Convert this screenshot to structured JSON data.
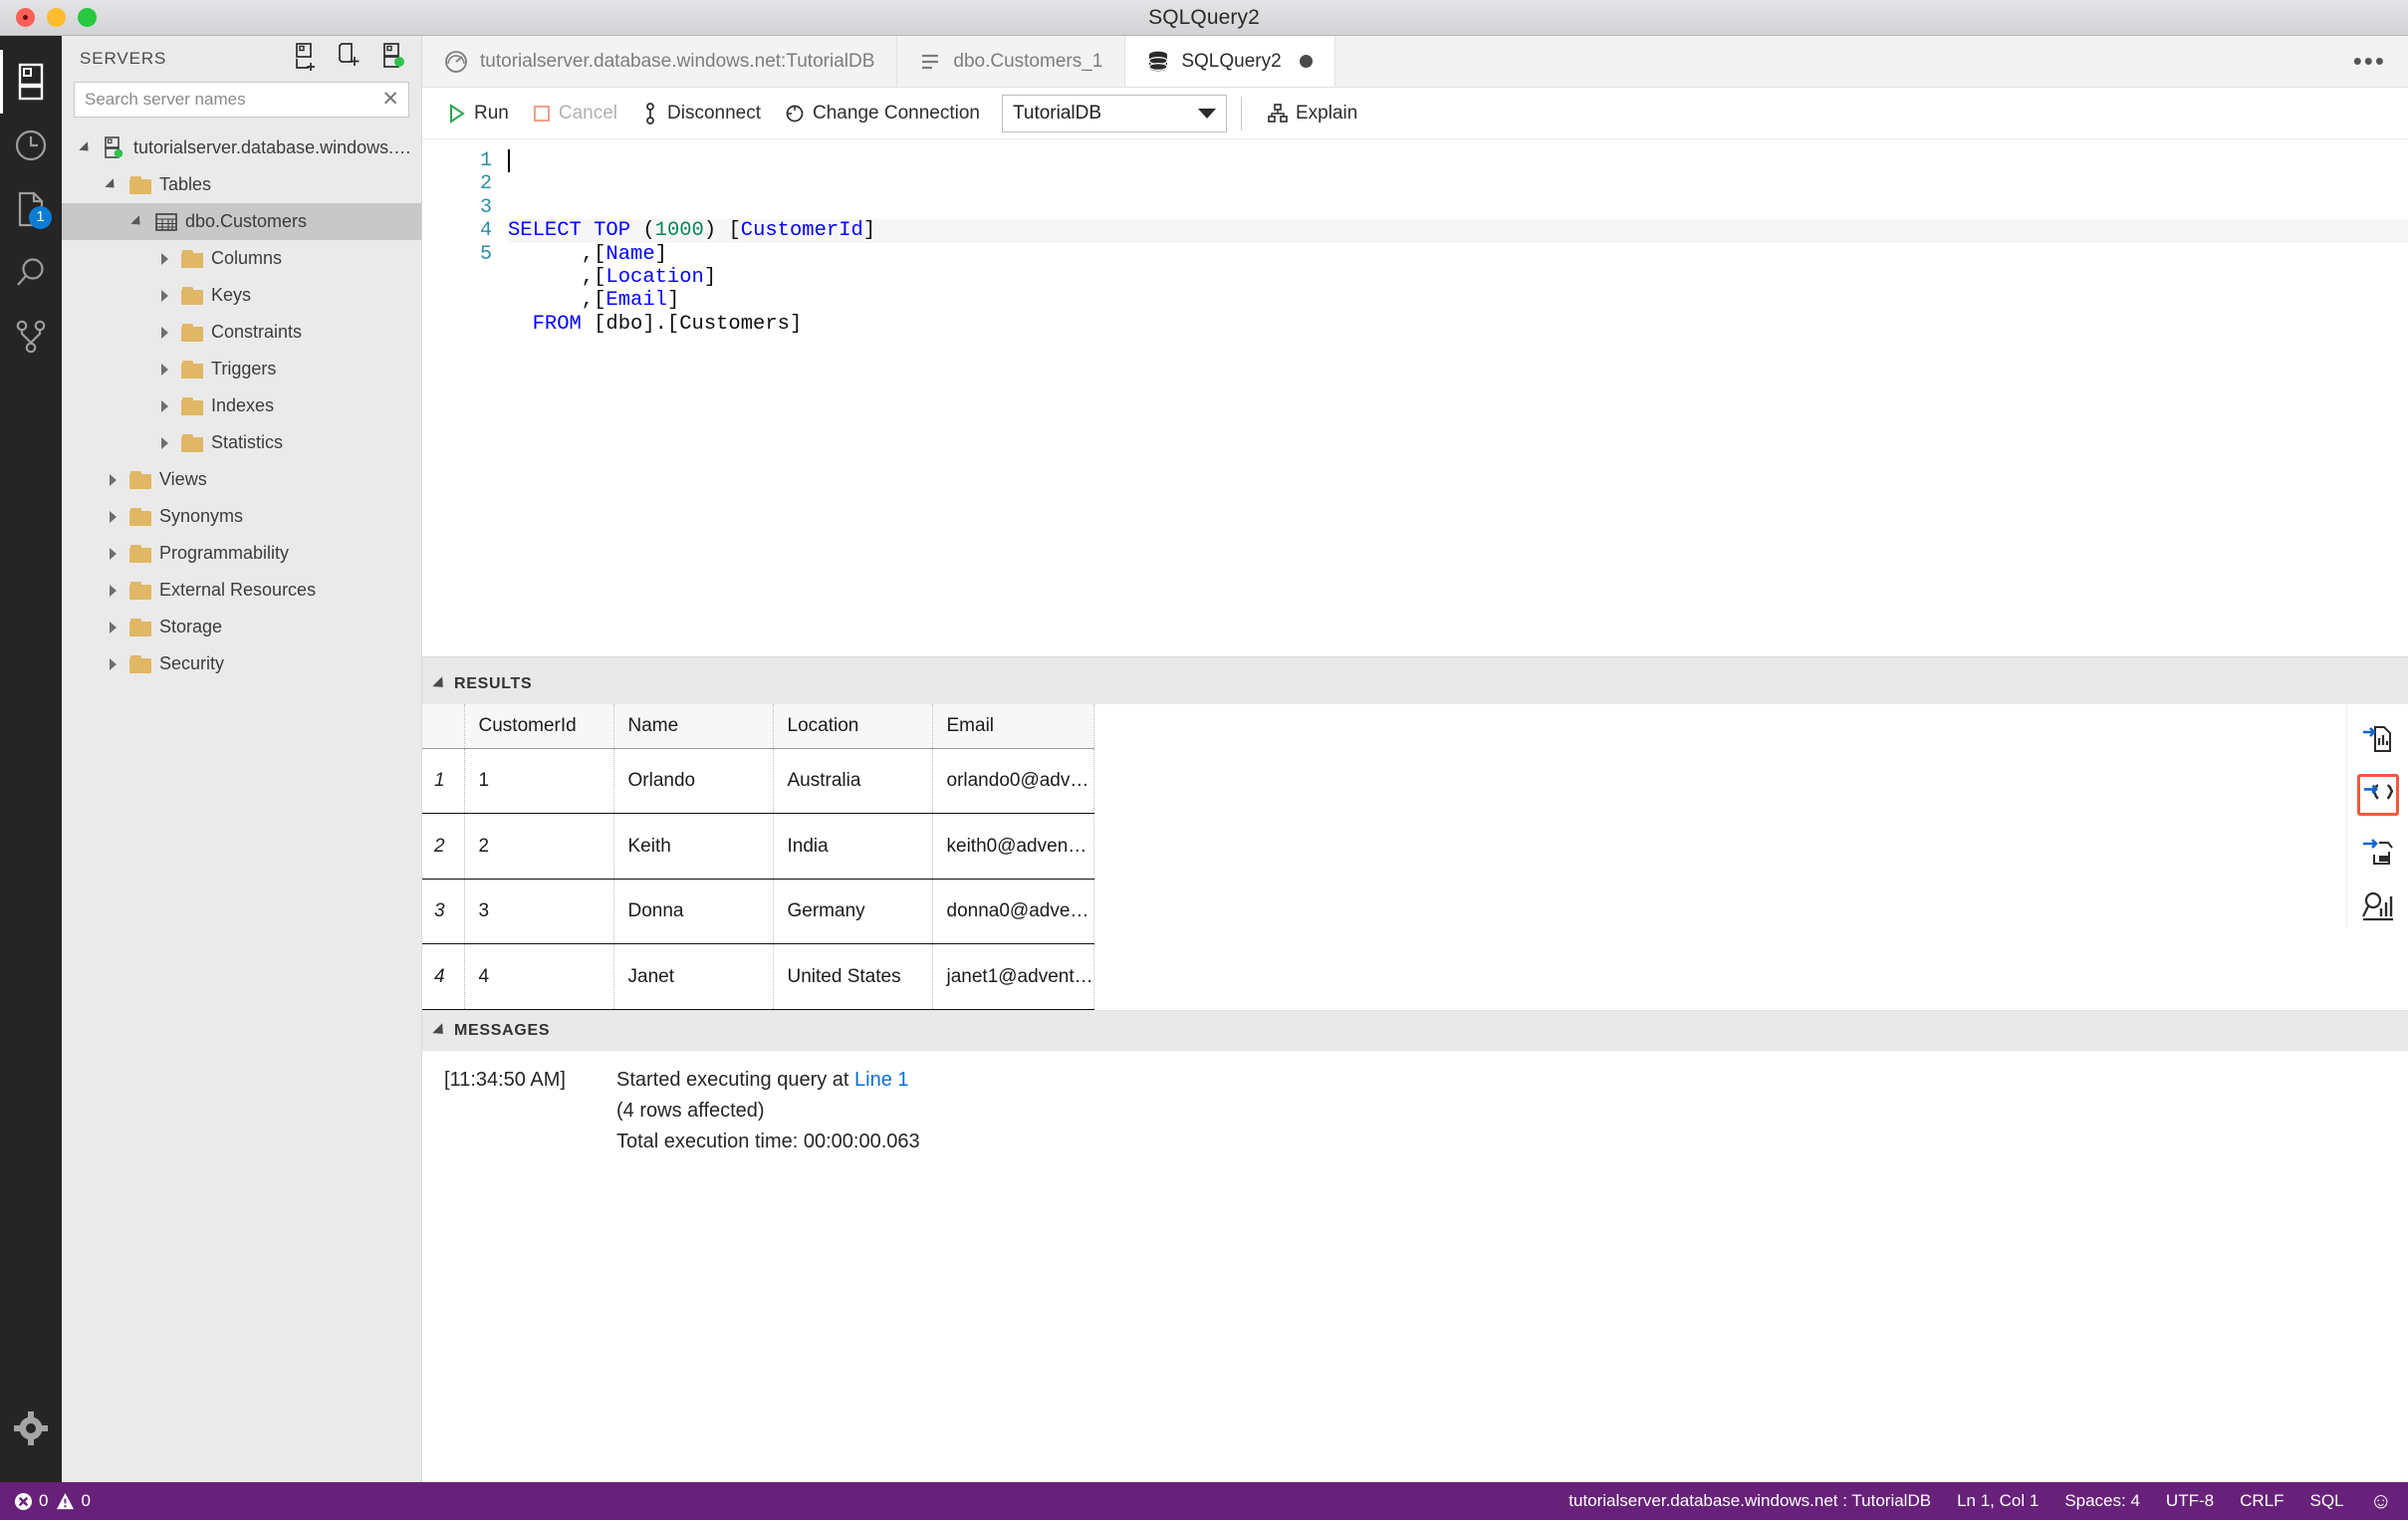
{
  "window": {
    "title": "SQLQuery2"
  },
  "activity_bar": {
    "items": [
      {
        "name": "servers-icon",
        "tooltip": "Servers",
        "active": true
      },
      {
        "name": "history-icon",
        "tooltip": "Query History",
        "active": false
      },
      {
        "name": "files-icon",
        "tooltip": "Explorer",
        "active": false,
        "badge": "1"
      },
      {
        "name": "search-icon",
        "tooltip": "Search",
        "active": false
      },
      {
        "name": "source-control-icon",
        "tooltip": "Source Control",
        "active": false
      }
    ],
    "settings": {
      "name": "gear-icon",
      "tooltip": "Manage"
    }
  },
  "sidebar": {
    "title": "SERVERS",
    "actions": [
      {
        "name": "new-connection-icon",
        "tooltip": "New Connection"
      },
      {
        "name": "new-server-group-icon",
        "tooltip": "New Server Group"
      },
      {
        "name": "show-active-connections-icon",
        "tooltip": "Show Active Connections"
      }
    ],
    "search": {
      "placeholder": "Search server names",
      "value": "",
      "clear": "✕"
    },
    "tree": [
      {
        "label": "tutorialserver.database.windows.n...",
        "icon": "server-connected-icon",
        "indent": 0,
        "state": "open"
      },
      {
        "label": "Tables",
        "icon": "folder-icon",
        "indent": 1,
        "state": "open"
      },
      {
        "label": "dbo.Customers",
        "icon": "table-icon",
        "indent": 2,
        "state": "open",
        "selected": true
      },
      {
        "label": "Columns",
        "icon": "folder-icon",
        "indent": 3,
        "state": "closed"
      },
      {
        "label": "Keys",
        "icon": "folder-icon",
        "indent": 3,
        "state": "closed"
      },
      {
        "label": "Constraints",
        "icon": "folder-icon",
        "indent": 3,
        "state": "closed"
      },
      {
        "label": "Triggers",
        "icon": "folder-icon",
        "indent": 3,
        "state": "closed"
      },
      {
        "label": "Indexes",
        "icon": "folder-icon",
        "indent": 3,
        "state": "closed"
      },
      {
        "label": "Statistics",
        "icon": "folder-icon",
        "indent": 3,
        "state": "closed"
      },
      {
        "label": "Views",
        "icon": "folder-icon",
        "indent": 1,
        "state": "closed"
      },
      {
        "label": "Synonyms",
        "icon": "folder-icon",
        "indent": 1,
        "state": "closed"
      },
      {
        "label": "Programmability",
        "icon": "folder-icon",
        "indent": 1,
        "state": "closed"
      },
      {
        "label": "External Resources",
        "icon": "folder-icon",
        "indent": 1,
        "state": "closed"
      },
      {
        "label": "Storage",
        "icon": "folder-icon",
        "indent": 1,
        "state": "closed"
      },
      {
        "label": "Security",
        "icon": "folder-icon",
        "indent": 1,
        "state": "closed"
      }
    ]
  },
  "tabs": [
    {
      "label": "tutorialserver.database.windows.net:TutorialDB",
      "icon": "dashboard-icon",
      "active": false,
      "dirty": false
    },
    {
      "label": "dbo.Customers_1",
      "icon": "table-designer-icon",
      "active": false,
      "dirty": false
    },
    {
      "label": "SQLQuery2",
      "icon": "database-icon",
      "active": true,
      "dirty": true
    }
  ],
  "tabs_more": "•••",
  "toolbar": {
    "run": "Run",
    "cancel": "Cancel",
    "disconnect": "Disconnect",
    "change_connection": "Change Connection",
    "database": "TutorialDB",
    "explain": "Explain"
  },
  "editor": {
    "line_numbers": [
      "1",
      "2",
      "3",
      "4",
      "5"
    ],
    "lines": [
      [
        {
          "t": "SELECT TOP ",
          "c": "kw"
        },
        {
          "t": "(",
          "c": ""
        },
        {
          "t": "1000",
          "c": "num"
        },
        {
          "t": ") ",
          "c": ""
        },
        {
          "t": "[",
          "c": ""
        },
        {
          "t": "CustomerId",
          "c": "id"
        },
        {
          "t": "]",
          "c": ""
        }
      ],
      [
        {
          "t": "      ,[",
          "c": ""
        },
        {
          "t": "Name",
          "c": "id"
        },
        {
          "t": "]",
          "c": ""
        }
      ],
      [
        {
          "t": "      ,[",
          "c": ""
        },
        {
          "t": "Location",
          "c": "id"
        },
        {
          "t": "]",
          "c": ""
        }
      ],
      [
        {
          "t": "      ,[",
          "c": ""
        },
        {
          "t": "Email",
          "c": "id"
        },
        {
          "t": "]",
          "c": ""
        }
      ],
      [
        {
          "t": "  FROM",
          "c": "kw"
        },
        {
          "t": " [dbo].[Customers]",
          "c": ""
        }
      ]
    ]
  },
  "results": {
    "section_title": "RESULTS",
    "columns": [
      "CustomerId",
      "Name",
      "Location",
      "Email"
    ],
    "rows": [
      {
        "n": "1",
        "cells": [
          "1",
          "Orlando",
          "Australia",
          "orlando0@adv…"
        ]
      },
      {
        "n": "2",
        "cells": [
          "2",
          "Keith",
          "India",
          "keith0@adven…"
        ]
      },
      {
        "n": "3",
        "cells": [
          "3",
          "Donna",
          "Germany",
          "donna0@adve…"
        ]
      },
      {
        "n": "4",
        "cells": [
          "4",
          "Janet",
          "United States",
          "janet1@advent…"
        ]
      }
    ],
    "actions": [
      {
        "name": "save-as-excel-icon",
        "tooltip": "Save As Excel",
        "selected": false
      },
      {
        "name": "save-as-json-icon",
        "tooltip": "Save As JSON",
        "selected": true
      },
      {
        "name": "save-as-csv-icon",
        "tooltip": "Save As CSV",
        "selected": false
      },
      {
        "name": "view-as-chart-icon",
        "tooltip": "View as Chart",
        "selected": false
      }
    ],
    "selected_action_color": "#f05a3c"
  },
  "messages": {
    "section_title": "MESSAGES",
    "timestamp": "[11:34:50 AM]",
    "line1_prefix": "Started executing query at ",
    "line1_link": "Line 1",
    "line2": "(4 rows affected)",
    "line3": "Total execution time: 00:00:00.063"
  },
  "statusbar": {
    "errors": "0",
    "warnings": "0",
    "connection": "tutorialserver.database.windows.net : TutorialDB",
    "cursor": "Ln 1, Col 1",
    "spaces": "Spaces: 4",
    "encoding": "UTF-8",
    "eol": "CRLF",
    "language": "SQL",
    "feedback": "☺",
    "background": "#68217a"
  }
}
